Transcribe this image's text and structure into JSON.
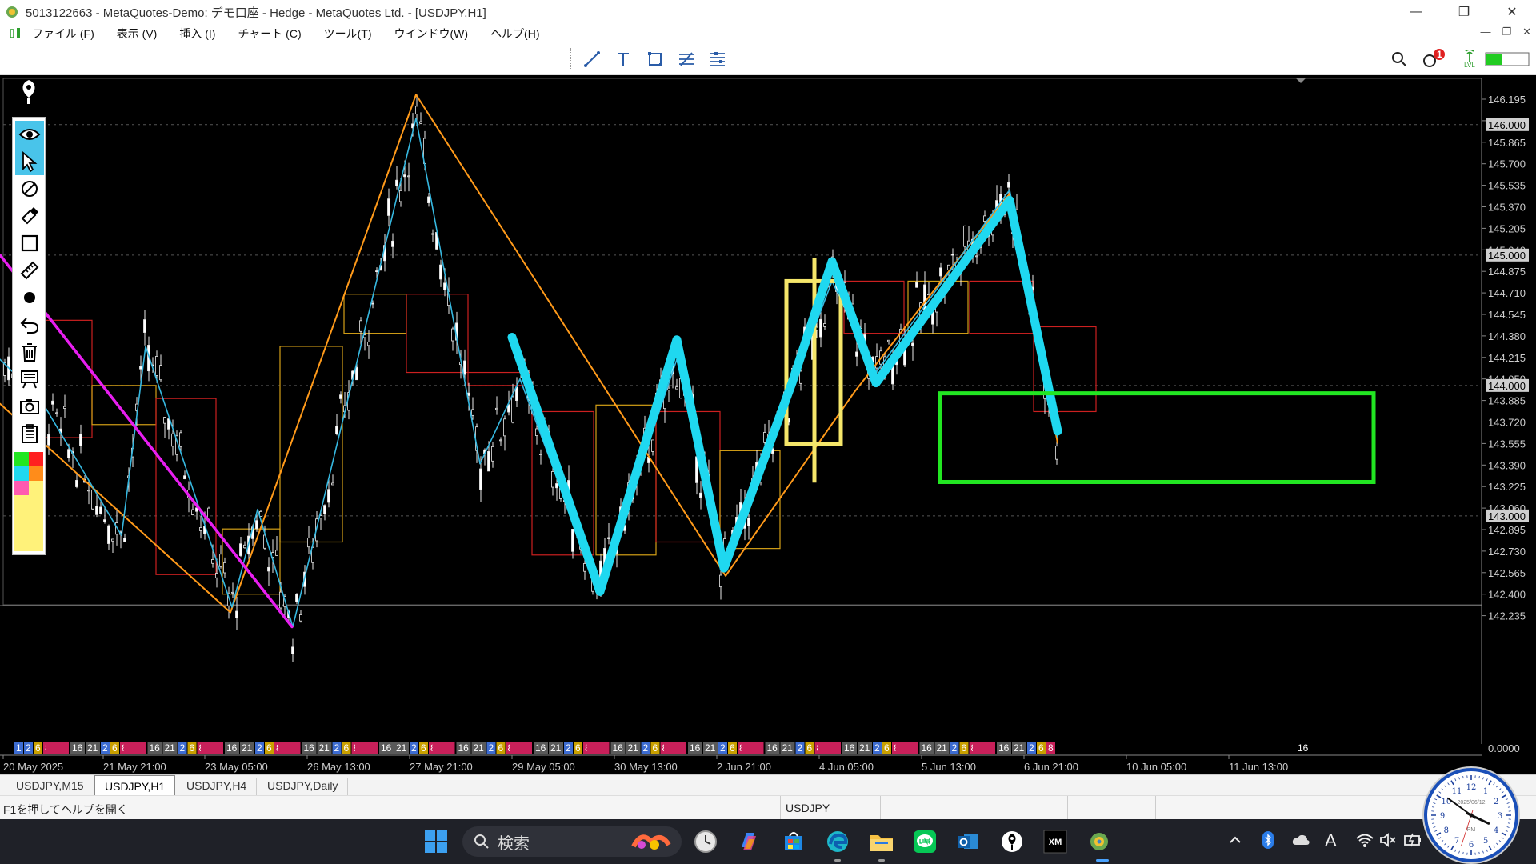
{
  "window": {
    "title": "5013122663 - MetaQuotes-Demo: デモ口座 - Hedge - MetaQuotes Ltd. - [USDJPY,H1]",
    "minimize": "—",
    "maximize": "❐",
    "close": "✕"
  },
  "menu": {
    "items": [
      "ファイル (F)",
      "表示 (V)",
      "挿入 (I)",
      "チャート (C)",
      "ツール(T)",
      "ウインドウ(W)",
      "ヘルプ(H)"
    ],
    "mdi": [
      "—",
      "❐",
      "✕"
    ]
  },
  "toolbar": {
    "notification_count": "1",
    "right_label": "LVL"
  },
  "colors": {
    "price_axis_text": "#cccccc",
    "grid_dashed": "#555555",
    "zigzag_orange": "#ff9a1a",
    "zigzag_cyan": "#36b8e0",
    "trend_magenta": "#e81ef0",
    "drawn_cyan": "#1fd8f0",
    "box_yellow": "#f5e66a",
    "box_green": "#22e622",
    "box_red": "#cc2020",
    "box_gold": "#d4a017",
    "sessions": {
      "asia": "#3d6cd1",
      "europe": "#5a5a5a",
      "ny": "#c8205a",
      "gold": "#c9a000"
    }
  },
  "chart_data": {
    "type": "candlestick",
    "symbol": "USDJPY",
    "timeframe": "H1",
    "y_axis": {
      "labels": [
        "146.195",
        "146.030",
        "145.865",
        "145.700",
        "145.535",
        "145.370",
        "145.205",
        "145.040",
        "144.875",
        "144.710",
        "144.545",
        "144.380",
        "144.215",
        "144.050",
        "143.885",
        "143.720",
        "143.555",
        "143.390",
        "143.225",
        "143.060",
        "142.895",
        "142.730",
        "142.565",
        "142.400",
        "142.235"
      ],
      "ylim": [
        142.1,
        146.3
      ],
      "highlighted": [
        "146.000",
        "145.000",
        "144.000",
        "143.000"
      ],
      "indicator_zero": "0.0000"
    },
    "x_axis": {
      "labels": [
        "20 May 2025",
        "21 May 21:00",
        "23 May 05:00",
        "26 May 13:00",
        "27 May 21:00",
        "29 May 05:00",
        "30 May 13:00",
        "2 Jun 21:00",
        "4 Jun 05:00",
        "5 Jun 13:00",
        "6 Jun 21:00",
        "10 Jun 05:00",
        "11 Jun 13:00"
      ]
    },
    "session_strip": {
      "first": [
        "1",
        "2",
        "6",
        "8"
      ],
      "block": [
        "16",
        "21",
        "2",
        "6",
        "8"
      ],
      "last": "16"
    },
    "zigzag_orange": [
      [
        0,
        143.86
      ],
      [
        288,
        142.26
      ],
      [
        520,
        146.23
      ],
      [
        907,
        142.54
      ],
      [
        1068,
        143.95
      ],
      [
        1262,
        145.47
      ],
      [
        1322,
        143.56
      ]
    ],
    "zigzag_cyan": [
      [
        0,
        144.2
      ],
      [
        50,
        143.9
      ],
      [
        152,
        142.85
      ],
      [
        182,
        144.3
      ],
      [
        290,
        142.3
      ],
      [
        322,
        143.05
      ],
      [
        366,
        142.15
      ],
      [
        520,
        146.05
      ],
      [
        600,
        143.4
      ],
      [
        650,
        144.05
      ],
      [
        720,
        142.9
      ],
      [
        750,
        142.45
      ],
      [
        846,
        144.2
      ],
      [
        905,
        142.6
      ],
      [
        1040,
        144.8
      ],
      [
        1095,
        144.1
      ],
      [
        1262,
        145.5
      ],
      [
        1322,
        143.6
      ]
    ],
    "trend_magenta": [
      [
        0,
        145.0
      ],
      [
        365,
        142.15
      ]
    ],
    "drawn_zigzag": [
      [
        640,
        144.37
      ],
      [
        750,
        142.42
      ],
      [
        846,
        144.35
      ],
      [
        905,
        142.6
      ],
      [
        990,
        144.02
      ],
      [
        1040,
        144.95
      ],
      [
        1095,
        144.02
      ],
      [
        1262,
        145.42
      ],
      [
        1322,
        143.65
      ]
    ],
    "yellow_box": {
      "x": [
        980,
        1050
      ],
      "body": [
        143.55,
        144.8
      ],
      "wick": [
        143.28,
        144.95
      ]
    },
    "green_box": {
      "x": [
        955,
        1495
      ],
      "price": [
        143.26,
        143.94
      ]
    },
    "h4_boxes": [
      {
        "x": [
          48,
          115
        ],
        "open": 144.5,
        "close": 143.6,
        "dir": "down"
      },
      {
        "x": [
          115,
          195
        ],
        "open": 143.7,
        "close": 144.0,
        "dir": "up"
      },
      {
        "x": [
          195,
          270
        ],
        "open": 143.9,
        "close": 142.55,
        "dir": "down"
      },
      {
        "x": [
          278,
          350
        ],
        "open": 142.4,
        "close": 142.9,
        "dir": "up"
      },
      {
        "x": [
          350,
          428
        ],
        "open": 142.8,
        "close": 144.3,
        "dir": "up"
      },
      {
        "x": [
          430,
          508
        ],
        "open": 144.4,
        "close": 144.7,
        "dir": "up"
      },
      {
        "x": [
          508,
          585
        ],
        "open": 144.7,
        "close": 144.1,
        "dir": "down"
      },
      {
        "x": [
          585,
          662
        ],
        "open": 144.1,
        "close": 144.0,
        "dir": "down"
      },
      {
        "x": [
          665,
          742
        ],
        "open": 143.8,
        "close": 142.7,
        "dir": "down"
      },
      {
        "x": [
          745,
          820
        ],
        "open": 142.7,
        "close": 143.85,
        "dir": "up"
      },
      {
        "x": [
          820,
          900
        ],
        "open": 143.8,
        "close": 142.8,
        "dir": "down"
      },
      {
        "x": [
          900,
          975
        ],
        "open": 142.75,
        "close": 143.5,
        "dir": "up"
      },
      {
        "x": [
          1055,
          1130
        ],
        "open": 144.8,
        "close": 144.4,
        "dir": "down"
      },
      {
        "x": [
          1135,
          1210
        ],
        "open": 144.4,
        "close": 144.8,
        "dir": "up"
      },
      {
        "x": [
          1212,
          1292
        ],
        "open": 144.8,
        "close": 144.4,
        "dir": "down"
      },
      {
        "x": [
          1292,
          1370
        ],
        "open": 144.45,
        "close": 143.8,
        "dir": "down"
      }
    ]
  },
  "tabs": [
    "USDJPY,M15",
    "USDJPY,H1",
    "USDJPY,H4",
    "USDJPY,Daily"
  ],
  "active_tab": "USDJPY,H1",
  "status": {
    "help": "F1を押してヘルプを開く",
    "symbol": "USDJPY"
  },
  "taskbar": {
    "search_label": "検索",
    "tray_font": "A"
  },
  "clock": {
    "date": "2025/06/12",
    "ampm": "PM",
    "numbers": [
      "12",
      "1",
      "2",
      "3",
      "4",
      "5",
      "6",
      "7",
      "8",
      "9",
      "10",
      "11"
    ],
    "hour": 3.85,
    "minute": 51,
    "second": 33
  }
}
